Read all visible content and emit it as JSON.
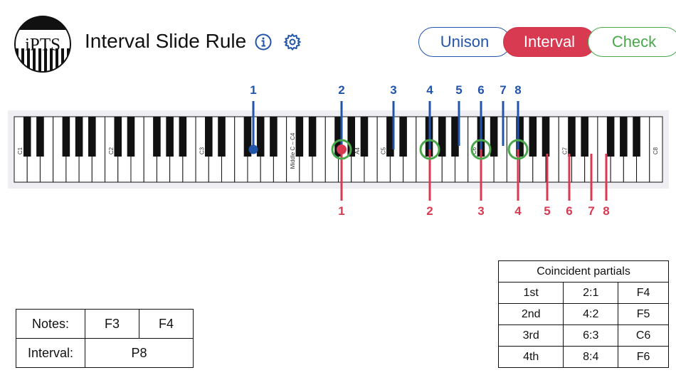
{
  "header": {
    "logo_text": "iPTS",
    "title": "Interval Slide Rule",
    "info_icon": "info-circle-icon",
    "settings_icon": "gear-icon"
  },
  "modes": {
    "unison": "Unison",
    "interval": "Interval",
    "check": "Check",
    "active": "Interval"
  },
  "colors": {
    "blue": "#2255aa",
    "red": "#d83a52",
    "green": "#49a84a"
  },
  "keyboard": {
    "white_keys": 50,
    "octave_labels": [
      "C1",
      "C2",
      "C3",
      "Middle C – C4",
      "A4",
      "C5",
      "C6",
      "C7",
      "C8"
    ]
  },
  "partials_top": {
    "labels": [
      "1",
      "2",
      "3",
      "4",
      "5",
      "6",
      "7",
      "8"
    ]
  },
  "partials_bottom": {
    "labels": [
      "1",
      "2",
      "3",
      "4",
      "5",
      "6",
      "7",
      "8"
    ]
  },
  "notes": {
    "notes_label": "Notes:",
    "note1": "F3",
    "note2": "F4",
    "interval_label": "Interval:",
    "interval_value": "P8"
  },
  "coincident": {
    "header": "Coincident partials",
    "rows": [
      [
        "1st",
        "2:1",
        "F4"
      ],
      [
        "2nd",
        "4:2",
        "F5"
      ],
      [
        "3rd",
        "6:3",
        "C6"
      ],
      [
        "4th",
        "8:4",
        "F6"
      ]
    ]
  }
}
